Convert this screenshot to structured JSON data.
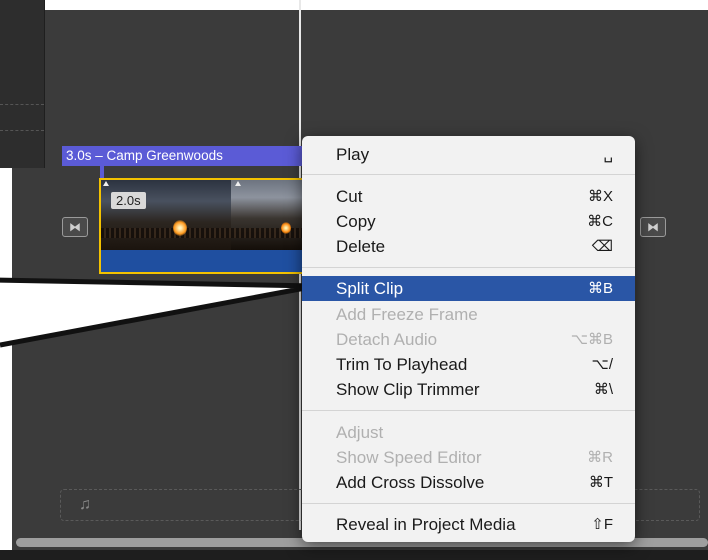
{
  "timeline": {
    "title_clip_label": "3.0s – Camp Greenwoods",
    "clip_duration": "2.0s",
    "transition_icon": "⧓",
    "music_icon": "♫"
  },
  "context_menu": {
    "items": [
      {
        "label": "Play",
        "shortcut": "␣",
        "enabled": true
      },
      {
        "label": "Cut",
        "shortcut": "⌘X",
        "enabled": true
      },
      {
        "label": "Copy",
        "shortcut": "⌘C",
        "enabled": true
      },
      {
        "label": "Delete",
        "shortcut": "⌫",
        "enabled": true
      },
      {
        "label": "Split Clip",
        "shortcut": "⌘B",
        "enabled": true,
        "selected": true
      },
      {
        "label": "Add Freeze Frame",
        "shortcut": "",
        "enabled": false
      },
      {
        "label": "Detach Audio",
        "shortcut": "⌥⌘B",
        "enabled": false
      },
      {
        "label": "Trim To Playhead",
        "shortcut": "⌥/",
        "enabled": true
      },
      {
        "label": "Show Clip Trimmer",
        "shortcut": "⌘\\",
        "enabled": true
      },
      {
        "label": "Adjust",
        "shortcut": "",
        "enabled": false
      },
      {
        "label": "Show Speed Editor",
        "shortcut": "⌘R",
        "enabled": false
      },
      {
        "label": "Add Cross Dissolve",
        "shortcut": "⌘T",
        "enabled": true
      },
      {
        "label": "Reveal in Project Media",
        "shortcut": "⇧F",
        "enabled": true
      }
    ]
  },
  "colors": {
    "selection": "#2a56a6",
    "title_clip": "#5b5bd6",
    "clip_border": "#f3c200"
  }
}
